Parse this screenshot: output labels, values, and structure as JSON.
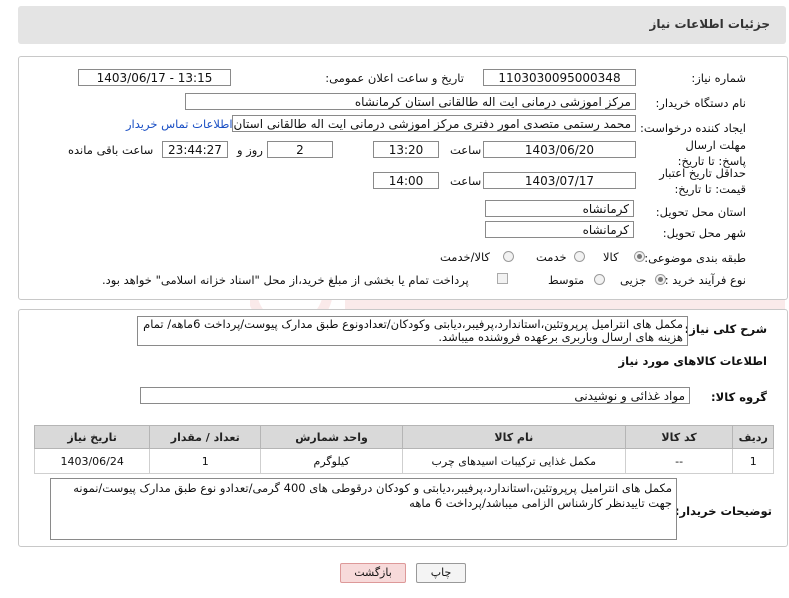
{
  "header": {
    "title": "جزئیات اطلاعات نیاز"
  },
  "form": {
    "need_number": {
      "label": "شماره نیاز:",
      "value": "1103030095000348"
    },
    "announce_datetime": {
      "label": "تاریخ و ساعت اعلان عمومی:",
      "value": "1403/06/17 - 13:15"
    },
    "buyer_org": {
      "label": "نام دستگاه خریدار:",
      "value": "مرکز اموزشی درمانی ایت اله طالقانی استان کرمانشاه"
    },
    "requester": {
      "label": "ایجاد کننده درخواست:",
      "value": "محمد رستمی متصدی امور دفتری مرکز اموزشی درمانی ایت اله طالقانی استان",
      "contact_link": "اطلاعات تماس خریدار"
    },
    "reply_deadline": {
      "label": "مهلت ارسال پاسخ: تا تاریخ:",
      "date": "1403/06/20",
      "time_label": "ساعت",
      "time": "13:20",
      "days": "2",
      "days_label": "روز و",
      "remaining": "23:44:27",
      "remaining_label": "ساعت باقی مانده"
    },
    "price_validity": {
      "label": "حداقل تاریخ اعتبار قیمت: تا تاریخ:",
      "date": "1403/07/17",
      "time_label": "ساعت",
      "time": "14:00"
    },
    "province": {
      "label": "استان محل تحویل:",
      "value": "کرمانشاه"
    },
    "city": {
      "label": "شهر محل تحویل:",
      "value": "کرمانشاه"
    },
    "category": {
      "label": "طبقه بندی موضوعی:",
      "options": [
        "کالا",
        "خدمت",
        "کالا/خدمت"
      ],
      "selected": "کالا"
    },
    "purchase_type": {
      "label": "نوع فرآیند خرید :",
      "options": [
        "جزیی",
        "متوسط"
      ],
      "selected": "جزیی",
      "payment_note": "پرداخت تمام یا بخشی از مبلغ خرید،از محل \"اسناد خزانه اسلامی\" خواهد بود."
    }
  },
  "description": {
    "label": "شرح کلی نیاز:",
    "text": "مکمل های انترامیل پرپروتئین،استاندارد،پرفیبر،دیابتی وکودکان/تعدادونوع طبق مدارک پیوست/پرداخت 6ماهه/ تمام هزینه های ارسال وباربری برعهده فروشنده میباشد."
  },
  "goods": {
    "section_title": "اطلاعات کالاهای مورد نیاز",
    "group_label": "گروه کالا:",
    "group_value": "مواد غذائی و نوشیدنی",
    "columns": [
      "ردیف",
      "کد کالا",
      "نام کالا",
      "واحد شمارش",
      "تعداد / مقدار",
      "تاریخ نیاز"
    ],
    "rows": [
      {
        "index": "1",
        "code": "--",
        "name": "مکمل غذایی ترکیبات اسیدهای چرب",
        "unit": "کیلوگرم",
        "qty": "1",
        "date": "1403/06/24"
      }
    ]
  },
  "buyer_notes": {
    "label": "توضیحات خریدار:",
    "text": "مکمل های انترامیل پرپروتئین،استاندارد،پرفیبر،دیابتی و کودکان درقوطی های 400 گرمی/تعدادو نوع طبق مدارک پیوست/نمونه جهت تاییدنظر کارشناس الزامی میباشد/پرداخت 6 ماهه"
  },
  "buttons": {
    "print": "چاپ",
    "back": "بازگشت"
  },
  "colors": {
    "header_bg": "#e4e4e4",
    "link": "#1a4fc4",
    "back_button_bg": "#f7dada",
    "print_button_bg": "#f4f4f4"
  }
}
